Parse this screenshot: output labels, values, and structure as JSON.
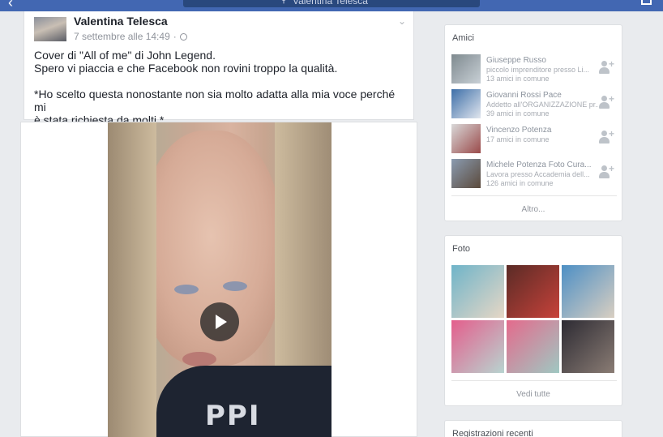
{
  "header": {
    "search_text": "Valentina Telesca"
  },
  "post": {
    "author": "Valentina Telesca",
    "timestamp": "7 settembre alle 14:49",
    "separator": "·",
    "text_lines": [
      "Cover di \"All of me\" di John Legend.",
      "Spero vi piaccia e che Facebook non rovini troppo la qualità.",
      "",
      "*Ho scelto questa nonostante non sia molto adatta alla mia voce perché mi",
      "è stata richiesta da molti.*"
    ],
    "shirt_text": "PPI"
  },
  "friends": {
    "title": "Amici",
    "items": [
      {
        "name": "Giuseppe Russo",
        "subtitle": "piccolo imprenditore presso Li...",
        "mutual": "13 amici in comune",
        "thumb": [
          "#7f8a8f",
          "#c8d0d6"
        ]
      },
      {
        "name": "Giovanni Rossi Pace",
        "subtitle": "Addetto all'ORGANIZZAZIONE pr...",
        "mutual": "39 amici in comune",
        "thumb": [
          "#3d6fa8",
          "#e1e6ee"
        ]
      },
      {
        "name": "Vincenzo Potenza",
        "subtitle": "",
        "mutual": "17 amici in comune",
        "thumb": [
          "#d9d9d9",
          "#9a4a4a"
        ]
      },
      {
        "name": "Michele Potenza Foto Cura...",
        "subtitle": "Lavora presso Accademia dell...",
        "mutual": "126 amici in comune",
        "thumb": [
          "#8a9bb0",
          "#5b4a3c"
        ]
      }
    ],
    "more_label": "Altro..."
  },
  "photos": {
    "title": "Foto",
    "items": [
      [
        "#6fb4c9",
        "#e6d7c6"
      ],
      [
        "#5a2b26",
        "#c7423a"
      ],
      [
        "#4d8fc4",
        "#d9cfc2"
      ],
      [
        "#e45e8c",
        "#b8d4d0"
      ],
      [
        "#e46a8c",
        "#9fc8c2"
      ],
      [
        "#2d2b33",
        "#8a7c74"
      ]
    ],
    "see_all_label": "Vedi tutte"
  },
  "recent": {
    "title": "Registrazioni recenti"
  },
  "colors": {
    "topbar": "#4267b2",
    "background": "#e9ebee"
  }
}
